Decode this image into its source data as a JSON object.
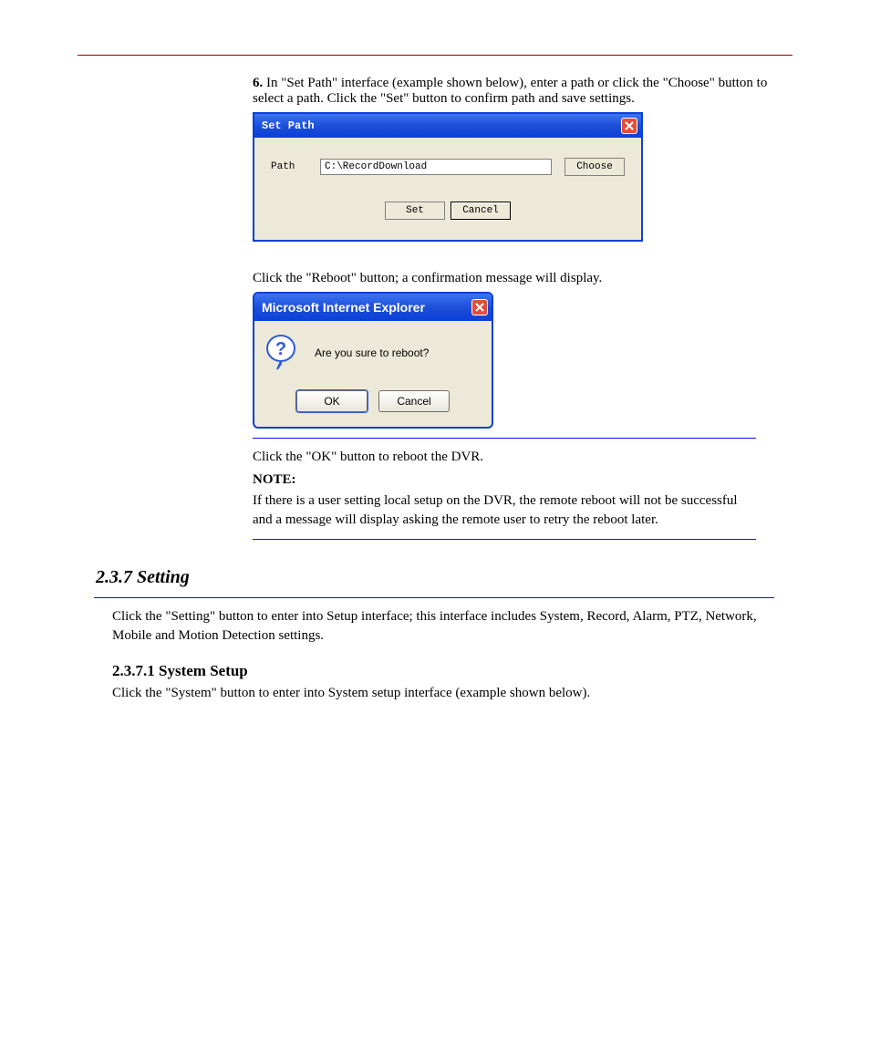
{
  "section1": {
    "num": "6.",
    "text": "In \"Set Path\" interface (example shown below), enter a path or click the \"Choose\" button to select a path. Click the \"Set\" button to confirm path and save settings."
  },
  "dialog1": {
    "title": "Set Path",
    "path_label": "Path",
    "path_value": "C:\\RecordDownload",
    "choose": "Choose",
    "set": "Set",
    "cancel": "Cancel"
  },
  "para_reboot": "Click the \"Reboot\" button; a confirmation message will display.",
  "dialog2": {
    "title": "Microsoft Internet Explorer",
    "message": "Are you sure to reboot?",
    "ok": "OK",
    "cancel": "Cancel"
  },
  "para_reboot2": "Click the \"OK\" button to reboot the DVR.",
  "note": {
    "title": "NOTE:",
    "body": "If there is a user setting local setup on the DVR, the remote reboot will not be successful and a message will display asking the remote user to retry the reboot later."
  },
  "heading_settings": "2.3.7 Setting",
  "para_settings": "Click the \"Setting\" button to enter into Setup interface; this interface includes System, Record, Alarm, PTZ, Network, Mobile and Motion Detection settings.",
  "heading_system": "2.3.7.1 System Setup",
  "para_system": "Click the \"System\" button to enter into System setup interface (example shown below)."
}
